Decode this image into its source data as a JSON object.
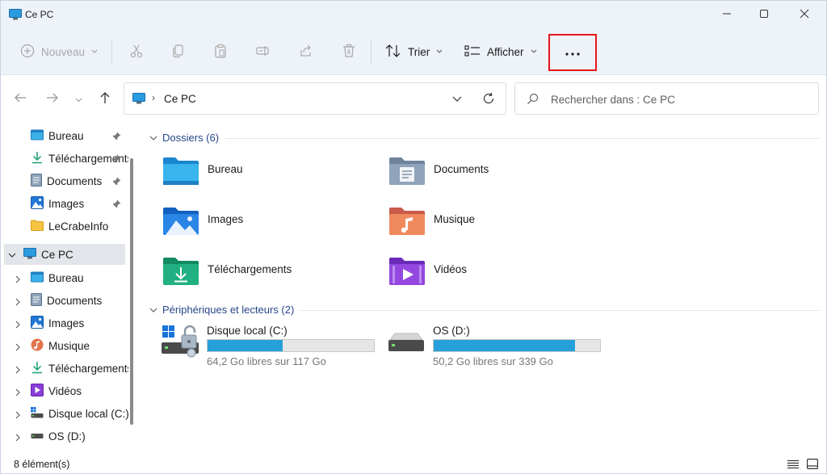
{
  "window": {
    "title": "Ce PC"
  },
  "toolbar": {
    "new_label": "Nouveau",
    "sort_label": "Trier",
    "view_label": "Afficher",
    "more_label": "···"
  },
  "address": {
    "location": "Ce PC",
    "separator": "›"
  },
  "search": {
    "placeholder": "Rechercher dans : Ce PC"
  },
  "sidebar": {
    "quick_access": [
      {
        "label": "Bureau",
        "icon": "desktop-folder-icon"
      },
      {
        "label": "Téléchargements",
        "icon": "download-folder-icon"
      },
      {
        "label": "Documents",
        "icon": "documents-folder-icon"
      },
      {
        "label": "Images",
        "icon": "images-folder-icon"
      },
      {
        "label": "LeCrabeInfo",
        "icon": "yellow-folder-icon"
      }
    ],
    "this_pc": {
      "label": "Ce PC",
      "icon": "computer-icon"
    },
    "this_pc_children": [
      {
        "label": "Bureau",
        "icon": "desktop-folder-icon"
      },
      {
        "label": "Documents",
        "icon": "documents-folder-icon"
      },
      {
        "label": "Images",
        "icon": "images-folder-icon"
      },
      {
        "label": "Musique",
        "icon": "music-icon"
      },
      {
        "label": "Téléchargements",
        "icon": "download-folder-icon"
      },
      {
        "label": "Vidéos",
        "icon": "videos-folder-icon"
      },
      {
        "label": "Disque local (C:)",
        "icon": "system-drive-icon"
      },
      {
        "label": "OS (D:)",
        "icon": "drive-icon"
      }
    ]
  },
  "content": {
    "folders_header": "Dossiers (6)",
    "folders": [
      {
        "name": "Bureau",
        "icon": "desktop-folder-icon"
      },
      {
        "name": "Documents",
        "icon": "documents-folder-icon"
      },
      {
        "name": "Images",
        "icon": "images-folder-icon"
      },
      {
        "name": "Musique",
        "icon": "music-folder-icon"
      },
      {
        "name": "Téléchargements",
        "icon": "download-folder-icon"
      },
      {
        "name": "Vidéos",
        "icon": "videos-folder-icon"
      }
    ],
    "drives_header": "Périphériques et lecteurs (2)",
    "drives": [
      {
        "name": "Disque local (C:)",
        "free": "64,2 Go libres sur 117 Go",
        "used_fraction": 0.45,
        "icon": "system-drive-locked-icon"
      },
      {
        "name": "OS (D:)",
        "free": "50,2 Go libres sur 339 Go",
        "used_fraction": 0.85,
        "icon": "drive-icon"
      }
    ]
  },
  "status": {
    "count": "8 élément(s)"
  },
  "colors": {
    "accent": "#26a0da",
    "highlight_box": "#e4161b",
    "group_header": "#26468a"
  }
}
